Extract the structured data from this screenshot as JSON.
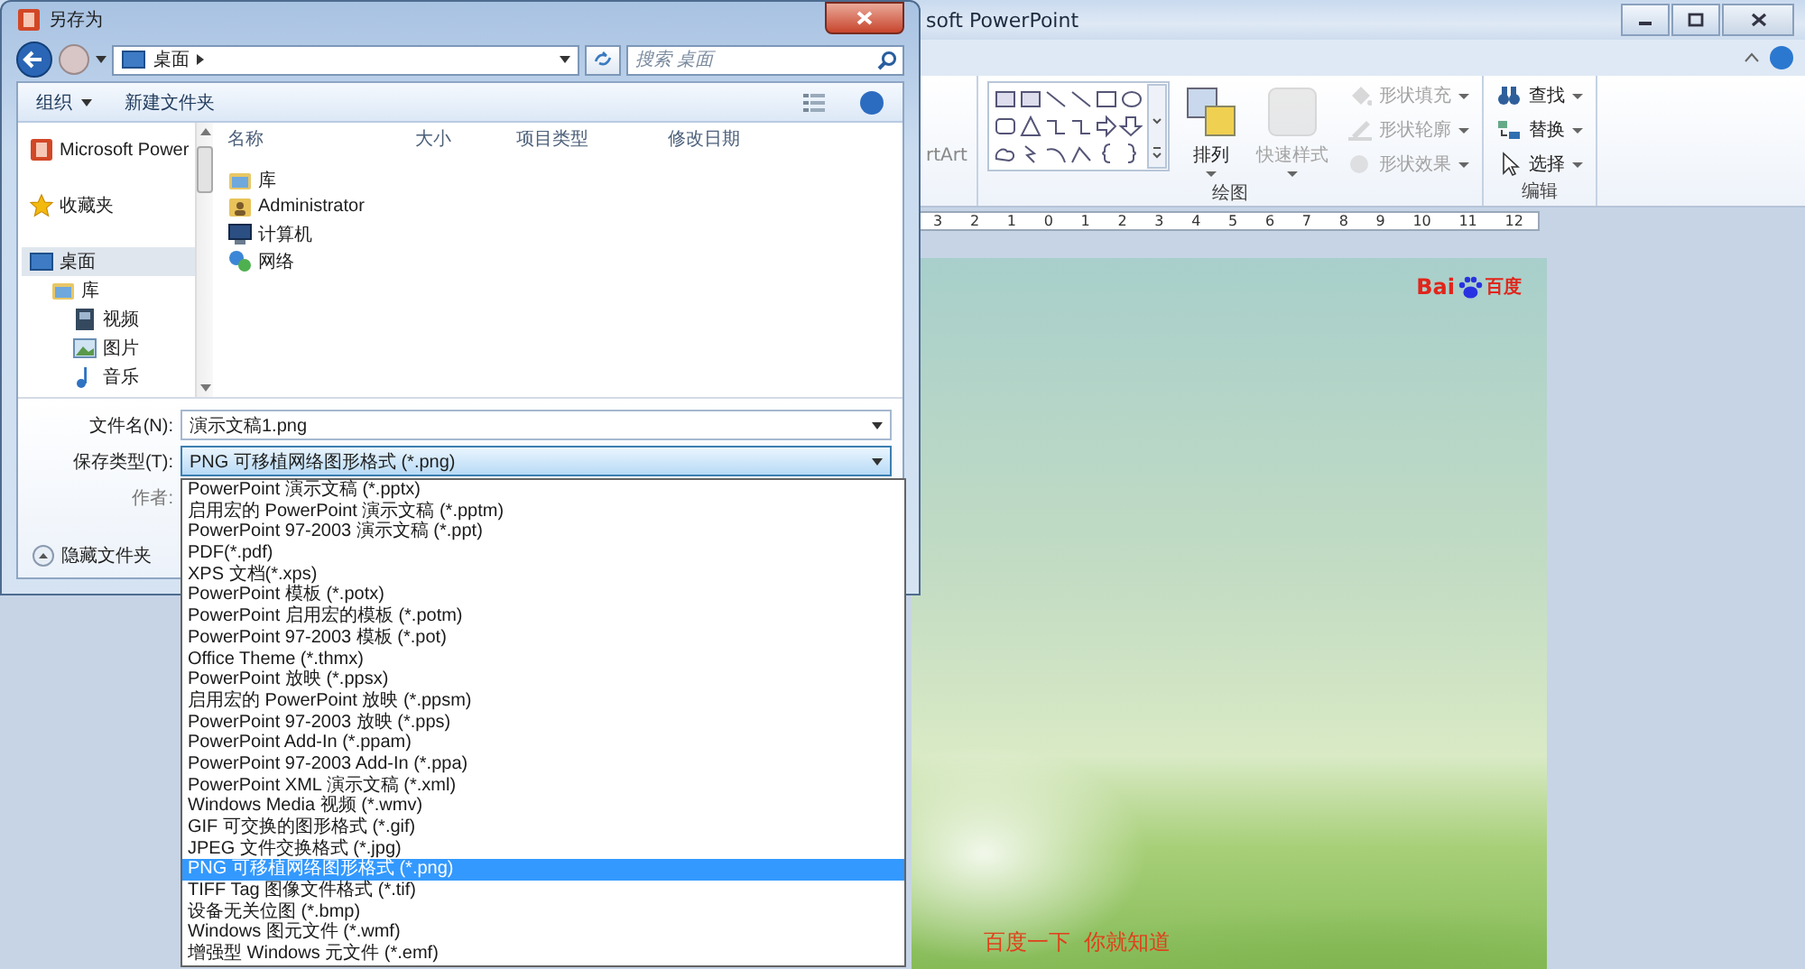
{
  "ppt": {
    "title": "soft PowerPoint",
    "ribbon": {
      "partial_group": "rtArt",
      "groups": [
        {
          "label": "绘图",
          "kind": "drawing",
          "buttons": [
            {
              "label": "排列",
              "kind": "arrange",
              "disabled": false
            },
            {
              "label": "快速样式",
              "kind": "quick-styles",
              "disabled": true
            },
            {
              "label": "形状填充",
              "kind": "fill",
              "disabled": true
            },
            {
              "label": "形状轮廓",
              "kind": "outline",
              "disabled": true
            },
            {
              "label": "形状效果",
              "kind": "effects",
              "disabled": true
            }
          ]
        },
        {
          "label": "编辑",
          "kind": "editing",
          "buttons": [
            {
              "label": "查找",
              "kind": "find",
              "disabled": false
            },
            {
              "label": "替换",
              "kind": "replace",
              "disabled": false
            },
            {
              "label": "选择",
              "kind": "select",
              "disabled": false
            }
          ]
        }
      ]
    },
    "ruler": [
      "3",
      "2",
      "1",
      "0",
      "1",
      "2",
      "3",
      "4",
      "5",
      "6",
      "7",
      "8",
      "9",
      "10",
      "11",
      "12"
    ],
    "slide": {
      "logo_latin": "Bai",
      "logo_cn": "百度",
      "caption": "百度一下  你就知道"
    }
  },
  "dialog": {
    "title": "另存为",
    "path": "桌面",
    "search_placeholder": "搜索 桌面",
    "toolbar": [
      {
        "label": "组织",
        "kind": "menu"
      },
      {
        "label": "新建文件夹",
        "kind": "plain"
      }
    ],
    "columns": [
      "名称",
      "大小",
      "项目类型",
      "修改日期"
    ],
    "nav": [
      {
        "label": "Microsoft Power",
        "kind": "app",
        "selected": false
      },
      {
        "label": "收藏夹",
        "kind": "favorites",
        "selected": false
      },
      {
        "label": "桌面",
        "kind": "desktop",
        "selected": true,
        "children": [
          {
            "label": "库",
            "kind": "library",
            "selected": false,
            "children": [
              {
                "label": "视频",
                "kind": "video",
                "selected": false
              },
              {
                "label": "图片",
                "kind": "pictures",
                "selected": false
              },
              {
                "label": "音乐",
                "kind": "music",
                "selected": false
              }
            ]
          }
        ]
      }
    ],
    "files": [
      {
        "name": "库",
        "kind": "library"
      },
      {
        "name": "Administrator",
        "kind": "user"
      },
      {
        "name": "计算机",
        "kind": "computer"
      },
      {
        "name": "网络",
        "kind": "network"
      }
    ],
    "filename_label": "文件名(N):",
    "filename": "演示文稿1.png",
    "type_label": "保存类型(T):",
    "type_value": "PNG 可移植网络图形格式 (*.png)",
    "author_label": "作者:",
    "hide_folders": "隐藏文件夹",
    "file_types": [
      {
        "label": "PowerPoint 演示文稿 (*.pptx)",
        "selected": false
      },
      {
        "label": "启用宏的 PowerPoint 演示文稿 (*.pptm)",
        "selected": false
      },
      {
        "label": "PowerPoint 97-2003 演示文稿 (*.ppt)",
        "selected": false
      },
      {
        "label": "PDF(*.pdf)",
        "selected": false
      },
      {
        "label": "XPS 文档(*.xps)",
        "selected": false
      },
      {
        "label": "PowerPoint 模板 (*.potx)",
        "selected": false
      },
      {
        "label": "PowerPoint 启用宏的模板 (*.potm)",
        "selected": false
      },
      {
        "label": "PowerPoint 97-2003 模板 (*.pot)",
        "selected": false
      },
      {
        "label": "Office Theme (*.thmx)",
        "selected": false
      },
      {
        "label": "PowerPoint 放映 (*.ppsx)",
        "selected": false
      },
      {
        "label": "启用宏的 PowerPoint 放映 (*.ppsm)",
        "selected": false
      },
      {
        "label": "PowerPoint 97-2003 放映 (*.pps)",
        "selected": false
      },
      {
        "label": "PowerPoint Add-In (*.ppam)",
        "selected": false
      },
      {
        "label": "PowerPoint 97-2003 Add-In (*.ppa)",
        "selected": false
      },
      {
        "label": "PowerPoint XML 演示文稿 (*.xml)",
        "selected": false
      },
      {
        "label": "Windows Media 视频 (*.wmv)",
        "selected": false
      },
      {
        "label": "GIF 可交换的图形格式 (*.gif)",
        "selected": false
      },
      {
        "label": "JPEG 文件交换格式 (*.jpg)",
        "selected": false
      },
      {
        "label": "PNG 可移植网络图形格式 (*.png)",
        "selected": true
      },
      {
        "label": "TIFF Tag 图像文件格式 (*.tif)",
        "selected": false
      },
      {
        "label": "设备无关位图 (*.bmp)",
        "selected": false
      },
      {
        "label": "Windows 图元文件 (*.wmf)",
        "selected": false
      },
      {
        "label": "增强型 Windows 元文件 (*.emf)",
        "selected": false
      }
    ]
  }
}
